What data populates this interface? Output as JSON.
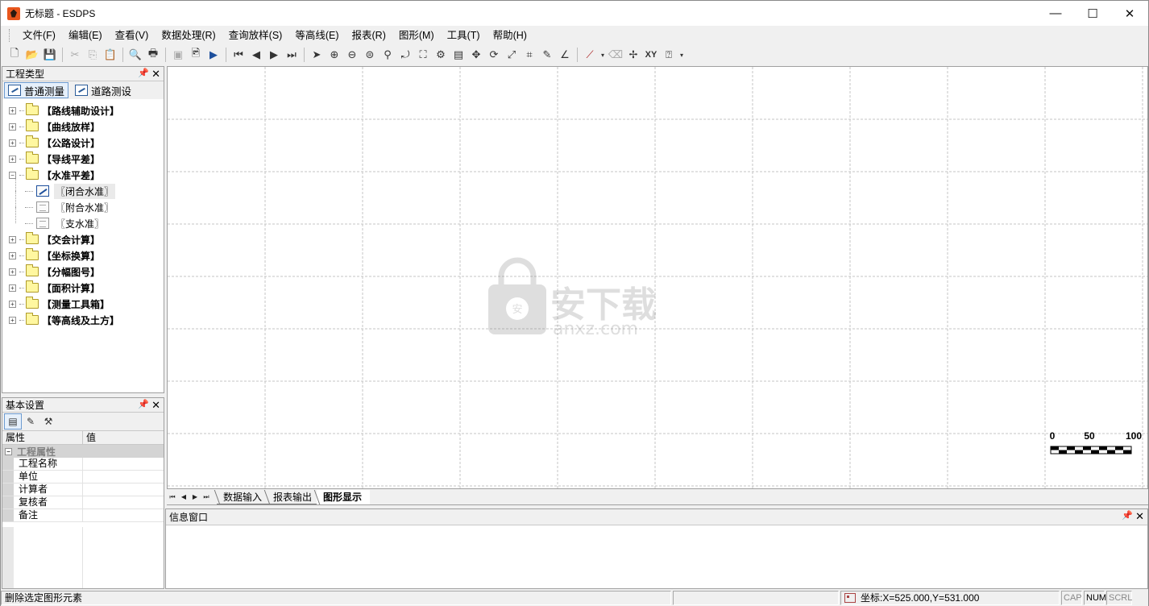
{
  "window": {
    "title": "无标题 - ESDPS",
    "minimize": "—",
    "maximize": "☐",
    "close": "✕"
  },
  "menu": [
    "文件(F)",
    "编辑(E)",
    "查看(V)",
    "数据处理(R)",
    "查询放样(S)",
    "等高线(E)",
    "报表(R)",
    "图形(M)",
    "工具(T)",
    "帮助(H)"
  ],
  "toolbar": {
    "xy_label": "XY"
  },
  "project_panel": {
    "title": "工程类型",
    "pin": "ᵖ",
    "close": "✕",
    "tabs": [
      {
        "label": "普通测量",
        "active": true
      },
      {
        "label": "道路测设",
        "active": false
      }
    ],
    "tree": [
      {
        "label": "【路线辅助设计】",
        "expanded": false
      },
      {
        "label": "【曲线放样】",
        "expanded": false
      },
      {
        "label": "【公路设计】",
        "expanded": false
      },
      {
        "label": "【导线平差】",
        "expanded": false
      },
      {
        "label": "【水准平差】",
        "expanded": true,
        "children": [
          {
            "label": "〖闭合水准〗",
            "selected": true
          },
          {
            "label": "〖附合水准〗",
            "selected": false
          },
          {
            "label": "〖支水准〗",
            "selected": false
          }
        ]
      },
      {
        "label": "【交会计算】",
        "expanded": false
      },
      {
        "label": "【坐标换算】",
        "expanded": false
      },
      {
        "label": "【分幅图号】",
        "expanded": false
      },
      {
        "label": "【面积计算】",
        "expanded": false
      },
      {
        "label": "【测量工具箱】",
        "expanded": false
      },
      {
        "label": "【等高线及土方】",
        "expanded": false
      }
    ]
  },
  "basic_panel": {
    "title": "基本设置",
    "pin": "ᵖ",
    "close": "✕",
    "col_property": "属性",
    "col_value": "值",
    "group": "工程属性",
    "rows": [
      "工程名称",
      "单位",
      "计算者",
      "复核者",
      "备注"
    ]
  },
  "scale_bar": {
    "labels": [
      "0",
      "50",
      "100"
    ]
  },
  "doc_tabs": [
    "数据输入",
    "报表输出",
    "图形显示"
  ],
  "active_doc_tab": 2,
  "info_panel": {
    "title": "信息窗口",
    "pin": "ᵖ",
    "close": "✕"
  },
  "status": {
    "message": "删除选定图形元素",
    "coord": "坐标:X=525.000,Y=531.000",
    "cap": "CAP",
    "num": "NUM",
    "scrl": "SCRL"
  }
}
